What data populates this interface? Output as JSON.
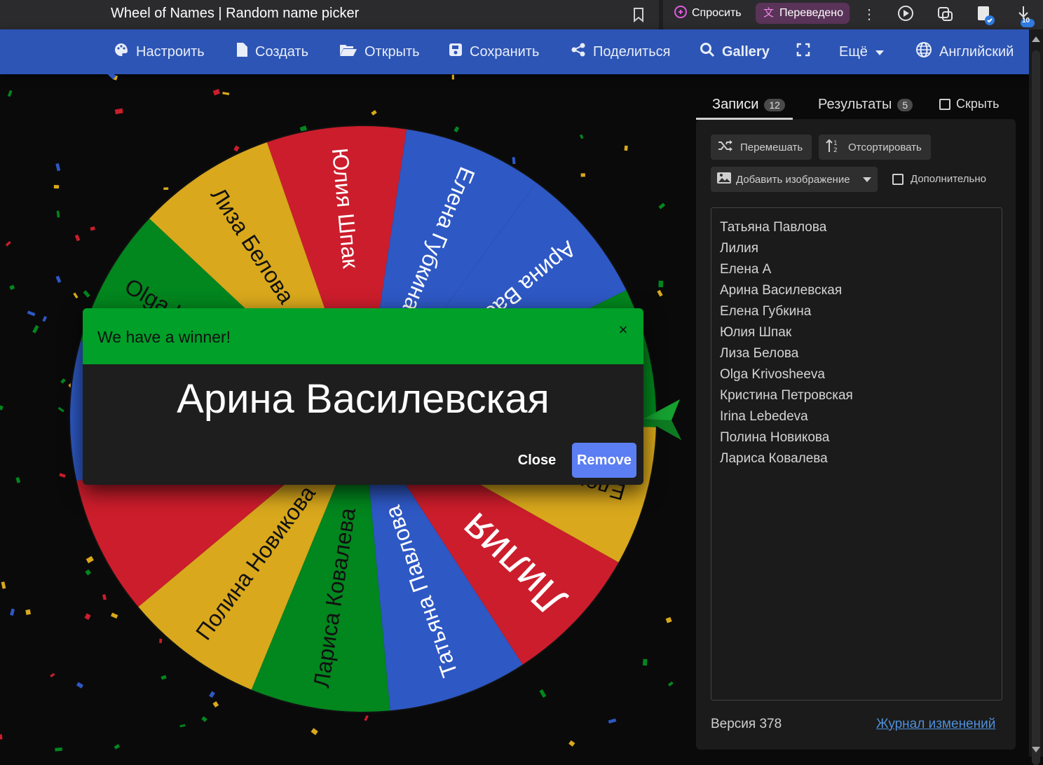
{
  "browser": {
    "tab_title": "Wheel of Names | Random name picker",
    "ask_label": "Спросить",
    "translated_label": "Переведено",
    "downloads_badge": "10"
  },
  "nav": {
    "items": [
      "Настроить",
      "Создать",
      "Открыть",
      "Сохранить",
      "Поделиться",
      "Gallery",
      "Ещё",
      "Английский"
    ],
    "color": "#2d55b5"
  },
  "wheel": {
    "segments": [
      {
        "label": "Лилия",
        "color": "#cc1d2c"
      },
      {
        "label": "Елена A",
        "color": "#d9a81c"
      },
      {
        "label": "",
        "color": "#02861e"
      },
      {
        "label": "Арина Василевская",
        "color": "#2e58c4"
      },
      {
        "label": "Елена Губкина",
        "color": "#2e58c4"
      },
      {
        "label": "Юлия Шпак",
        "color": "#cc1d2c"
      },
      {
        "label": "Лиза Белова",
        "color": "#d9a81c"
      },
      {
        "label": "Olga Krivosheeva",
        "color": "#02861e"
      },
      {
        "label": "",
        "color": "#2e58c4"
      },
      {
        "label": "",
        "color": "#cc1d2c"
      },
      {
        "label": "Полина Новикова",
        "color": "#d9a81c"
      },
      {
        "label": "Лариса Ковалева",
        "color": "#02861e"
      },
      {
        "label": "Татьяна Павлова",
        "color": "#2e58c4"
      }
    ]
  },
  "dialog": {
    "title": "We have a winner!",
    "close_icon": "×",
    "winner": "Арина Василевская",
    "close_label": "Close",
    "remove_label": "Remove"
  },
  "panel": {
    "tab_entries": "Записи",
    "entries_count": "12",
    "tab_results": "Результаты",
    "results_count": "5",
    "hide_label": "Скрыть",
    "shuffle_label": "Перемешать",
    "sort_label": "Отсортировать",
    "add_image_label": "Добавить изображение",
    "advanced_label": "Дополнительно",
    "entries": [
      "Татьяна Павлова",
      "Лилия",
      "Елена A",
      "Арина Василевская",
      "Елена Губкина",
      "Юлия Шпак",
      "Лиза Белова",
      "Olga Krivosheeva",
      "Кристина Петровская",
      "Irina Lebedeva",
      "Полина Новикова",
      "Лариса Ковалева"
    ],
    "version": "Версия 378",
    "changelog": "Журнал изменений"
  }
}
